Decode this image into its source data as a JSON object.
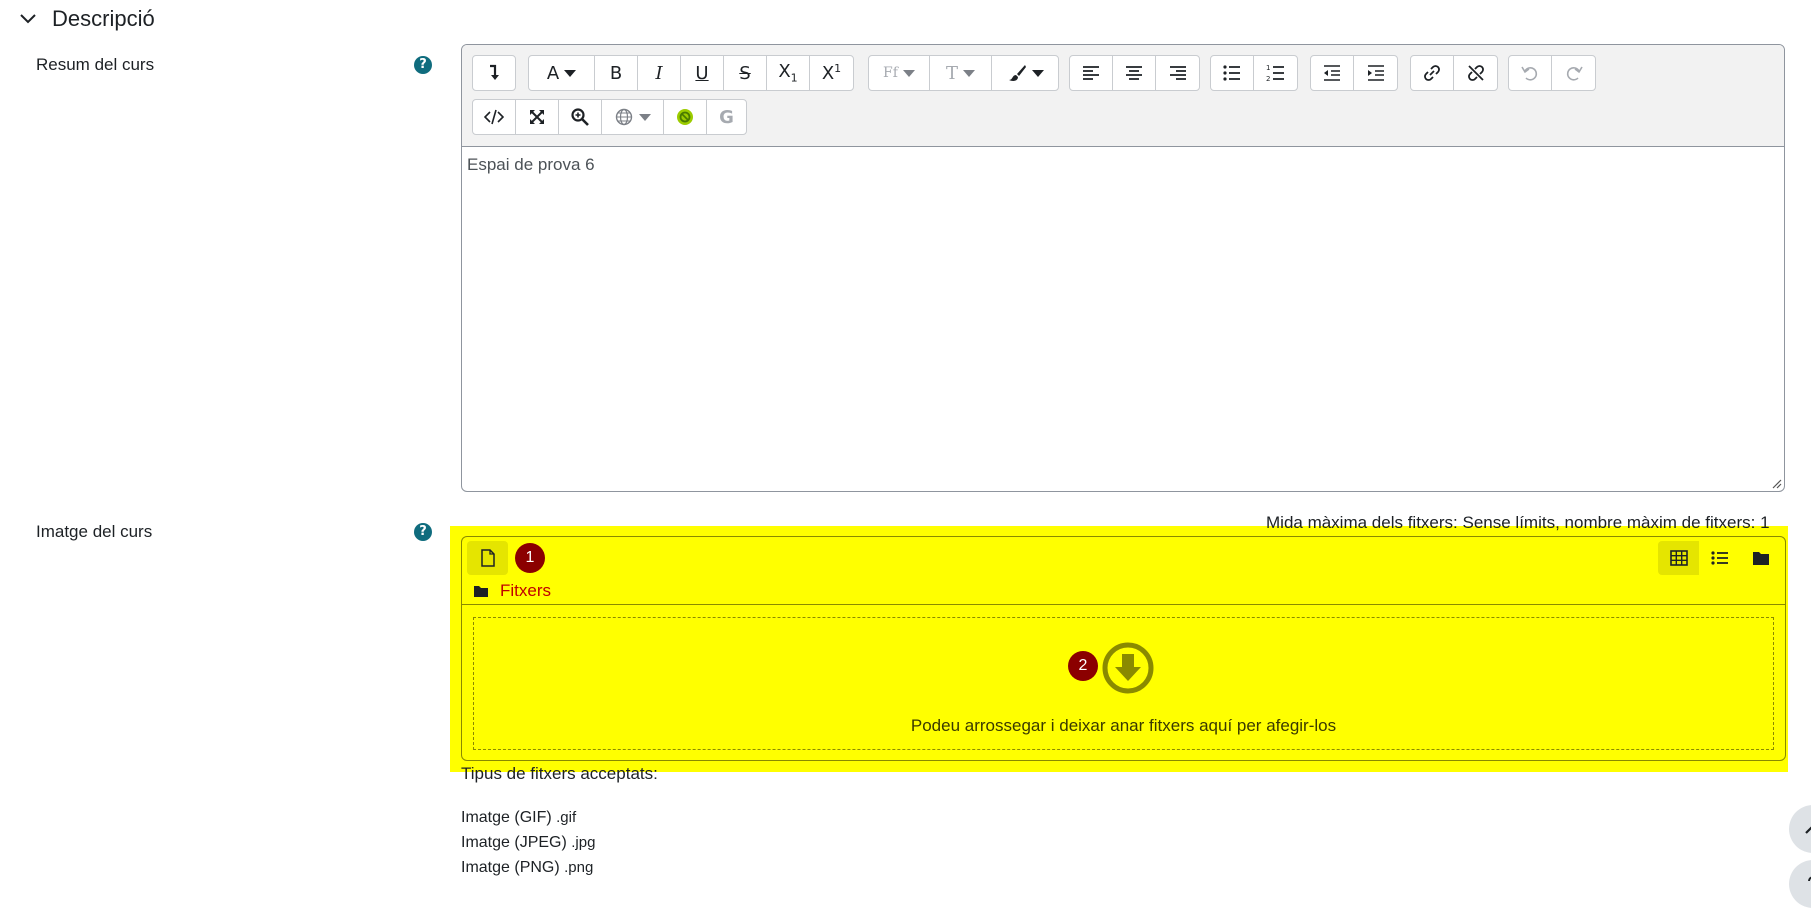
{
  "section": {
    "title": "Descripció"
  },
  "summary": {
    "label": "Resum del curs",
    "help": "?",
    "content": "Espai de prova 6"
  },
  "toolbar": {
    "font_family_label": "Ff",
    "font_size_label": "T",
    "direction_label": "G"
  },
  "image": {
    "label": "Imatge del curs",
    "help": "?",
    "max_size": "Mida màxima dels fitxers: Sense límits, nombre màxim de fitxers: 1",
    "badge_1": "1",
    "badge_2": "2",
    "folder_label": "Fitxers",
    "drop_text": "Podeu arrossegar i deixar anar fitxers aquí per afegir-los",
    "accepted_title": "Tipus de fitxers acceptats:",
    "types": [
      {
        "name": "Imatge (GIF)",
        "ext": ".gif"
      },
      {
        "name": "Imatge (JPEG)",
        "ext": ".jpg"
      },
      {
        "name": "Imatge (PNG)",
        "ext": ".png"
      }
    ]
  },
  "colors": {
    "highlight": "#ffff00",
    "badge": "#8b0000",
    "help": "#0f6c7e",
    "link": "#c00000"
  }
}
